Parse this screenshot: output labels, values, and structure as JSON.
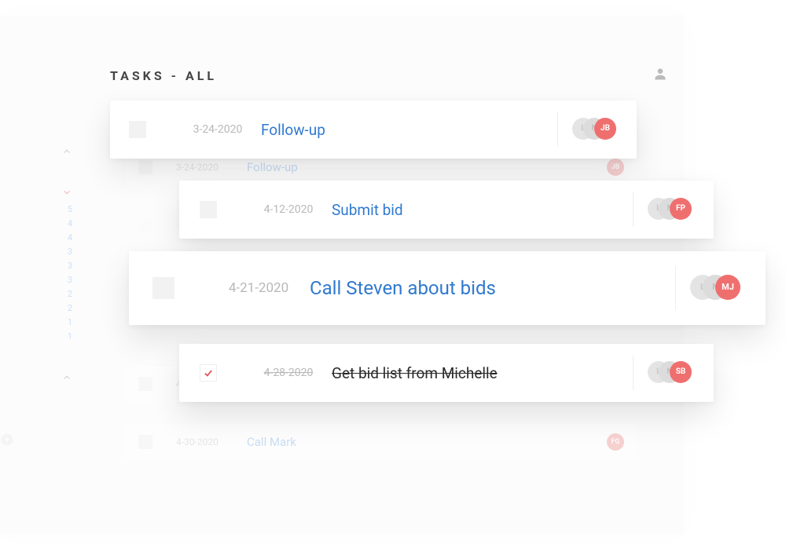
{
  "header": {
    "title": "TASKS - ALL"
  },
  "sidebar": {
    "counts": [
      5,
      4,
      4,
      3,
      3,
      3,
      2,
      2,
      1,
      1
    ]
  },
  "bg_tasks": [
    {
      "date": "3-24-2020",
      "label": "Follow-up",
      "initials": "JB",
      "completed": false
    },
    {
      "date": "4-12-2020",
      "label": "Submit bid",
      "initials": "FP",
      "completed": false
    },
    {
      "date": "4-21-2020",
      "label": "Call Steven about bids",
      "initials": "MJ",
      "completed": false
    },
    {
      "date": "4-28-2020",
      "label": "Get bid list from Michelle",
      "initials": "SB",
      "completed": false
    },
    {
      "date": "4-30-2020",
      "label": "Call Mark",
      "initials": "FG",
      "completed": false
    }
  ],
  "fg_cards": [
    {
      "date": "3-24-2020",
      "label": "Follow-up",
      "initials": "JB",
      "completed": false
    },
    {
      "date": "4-12-2020",
      "label": "Submit bid",
      "initials": "FP",
      "completed": false
    },
    {
      "date": "4-21-2020",
      "label": "Call Steven about bids",
      "initials": "MJ",
      "completed": false
    },
    {
      "date": "4-28-2020",
      "label": "Get bid list from Michelle",
      "initials": "SB",
      "completed": true
    }
  ],
  "avatar_ghost_1": "L",
  "avatar_ghost_2": "N"
}
